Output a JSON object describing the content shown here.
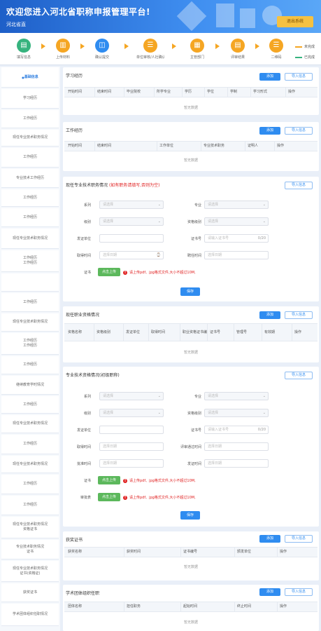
{
  "header": {
    "title": "欢迎您进入河北省职称申报管理平台!",
    "subtitle": "河北省直",
    "exit_label": "退出系统"
  },
  "steps": [
    {
      "label": "填写信息",
      "color": "#36b37e",
      "icon": "▤"
    },
    {
      "label": "上传材料",
      "color": "#f5a623",
      "icon": "▥"
    },
    {
      "label": "确认提交",
      "color": "#2f8cf0",
      "icon": "◫"
    },
    {
      "label": "单位审核/人社确认",
      "color": "#f5a623",
      "icon": "☰"
    },
    {
      "label": "主管部门",
      "color": "#f5a623",
      "icon": "▦"
    },
    {
      "label": "评审结果",
      "color": "#f5a623",
      "icon": "▤"
    },
    {
      "label": "二维码",
      "color": "#f5a623",
      "icon": "☰"
    }
  ],
  "legend": {
    "pending": "未完成",
    "done": "已完成",
    "pending_color": "#f5a623",
    "done_color": "#36b37e"
  },
  "sidebar": [
    {
      "label": "基础信息",
      "active": true
    },
    {
      "label": "学习经历"
    },
    {
      "label": "工作经历"
    },
    {
      "label": "现任专业技术职务情况"
    },
    {
      "label": "工作经历"
    },
    {
      "label": "专业技术工作经历"
    },
    {
      "label": "工作经历"
    },
    {
      "label": "工作经历"
    },
    {
      "label": "现任专业技术职务情况"
    },
    {
      "label": "工作经历\n工作经历"
    },
    {
      "label": ""
    },
    {
      "label": "工作经历"
    },
    {
      "label": "现任专业技术职务情况"
    },
    {
      "label": "工作经历\n工作经历"
    },
    {
      "label": "工作经历"
    },
    {
      "label": "继续教育学时情况"
    },
    {
      "label": "工作经历"
    },
    {
      "label": "现任专业技术职务情况"
    },
    {
      "label": "工作经历"
    },
    {
      "label": "现任专业技术职务情况"
    },
    {
      "label": "工作经历"
    },
    {
      "label": "工作经历"
    },
    {
      "label": "现任专业技术职务情况\n资格证书"
    },
    {
      "label": "专业技术职务情况\n证书"
    },
    {
      "label": "现任专业技术职务情况\n证书(资格证)"
    },
    {
      "label": "获奖证书"
    },
    {
      "label": "学术团体组织任职情况"
    }
  ],
  "study": {
    "title": "学习经历",
    "add_label": "添加",
    "import_label": "导入信息",
    "columns": [
      "开始时间",
      "结束时间",
      "毕业院校",
      "所学专业",
      "学历",
      "学位",
      "学制",
      "学习形式",
      "操作"
    ],
    "empty": "暂无数据"
  },
  "work": {
    "title": "工作经历",
    "add_label": "添加",
    "import_label": "导入信息",
    "columns": [
      "开始时间",
      "结束时间",
      "工作单位",
      "专业技术职务",
      "证明人",
      "操作"
    ],
    "empty": "暂无数据"
  },
  "current": {
    "title": "现任专业技术职务情况",
    "note": "(如有职务请填写,否则为空)",
    "import_label": "导入信息",
    "fields": {
      "series": "系列",
      "major": "专业",
      "level": "级别",
      "cert_level": "资格级别",
      "issuer": "发证单位",
      "cert_no": "证书号",
      "get_date": "取得时间",
      "hire_date": "聘任时间"
    },
    "select_placeholder": "请选择",
    "date_placeholder": "选择日期",
    "cert_placeholder": "请输入证书号",
    "counter": "0/20",
    "attach_label": "证书",
    "upload_label": "点击上传",
    "warn": "请上传pdf、jpg格式文件,大小不超过10M,",
    "save_label": "保存"
  },
  "practice": {
    "title": "现任职业资格情况",
    "add_label": "添加",
    "import_label": "导入信息",
    "columns": [
      "资格名称",
      "资格级别",
      "发证单位",
      "取得时间",
      "职业资格证书编号",
      "证书号",
      "管理号",
      "有效期",
      "操作"
    ],
    "empty": "暂无数据"
  },
  "detail": {
    "title": "专业技术资格情况(初级职称)",
    "note": "",
    "import_label": "导入信息",
    "fields": {
      "series": "系列",
      "major": "专业",
      "level": "级别",
      "cert_level": "资格级别",
      "issuer": "发证单位",
      "cert_no": "证书号",
      "get_date": "取得时间",
      "audit_date": "评审通过时间",
      "approve_date": "批准时间",
      "cert_date": "发证时间"
    },
    "select_placeholder": "请选择",
    "date_placeholder": "选择日期",
    "cert_placeholder": "请输入证书号",
    "counter": "0/20",
    "attach1_label": "证书",
    "attach2_label": "审批表",
    "upload_label": "点击上传",
    "warn": "请上传pdf、jpg格式文件,大小不超过10M,",
    "save_label": "保存"
  },
  "awards": {
    "title": "获奖证书",
    "add_label": "添加",
    "import_label": "导入信息",
    "columns": [
      "获奖名称",
      "获奖时间",
      "证书编号",
      "颁发单位",
      "操作"
    ],
    "empty": "暂无数据"
  },
  "society": {
    "title": "学术团体组织任职",
    "add_label": "添加",
    "import_label": "导入信息",
    "columns": [
      "团体名称",
      "担任职务",
      "起始时间",
      "终止时间",
      "操作"
    ],
    "empty": "暂无数据"
  }
}
